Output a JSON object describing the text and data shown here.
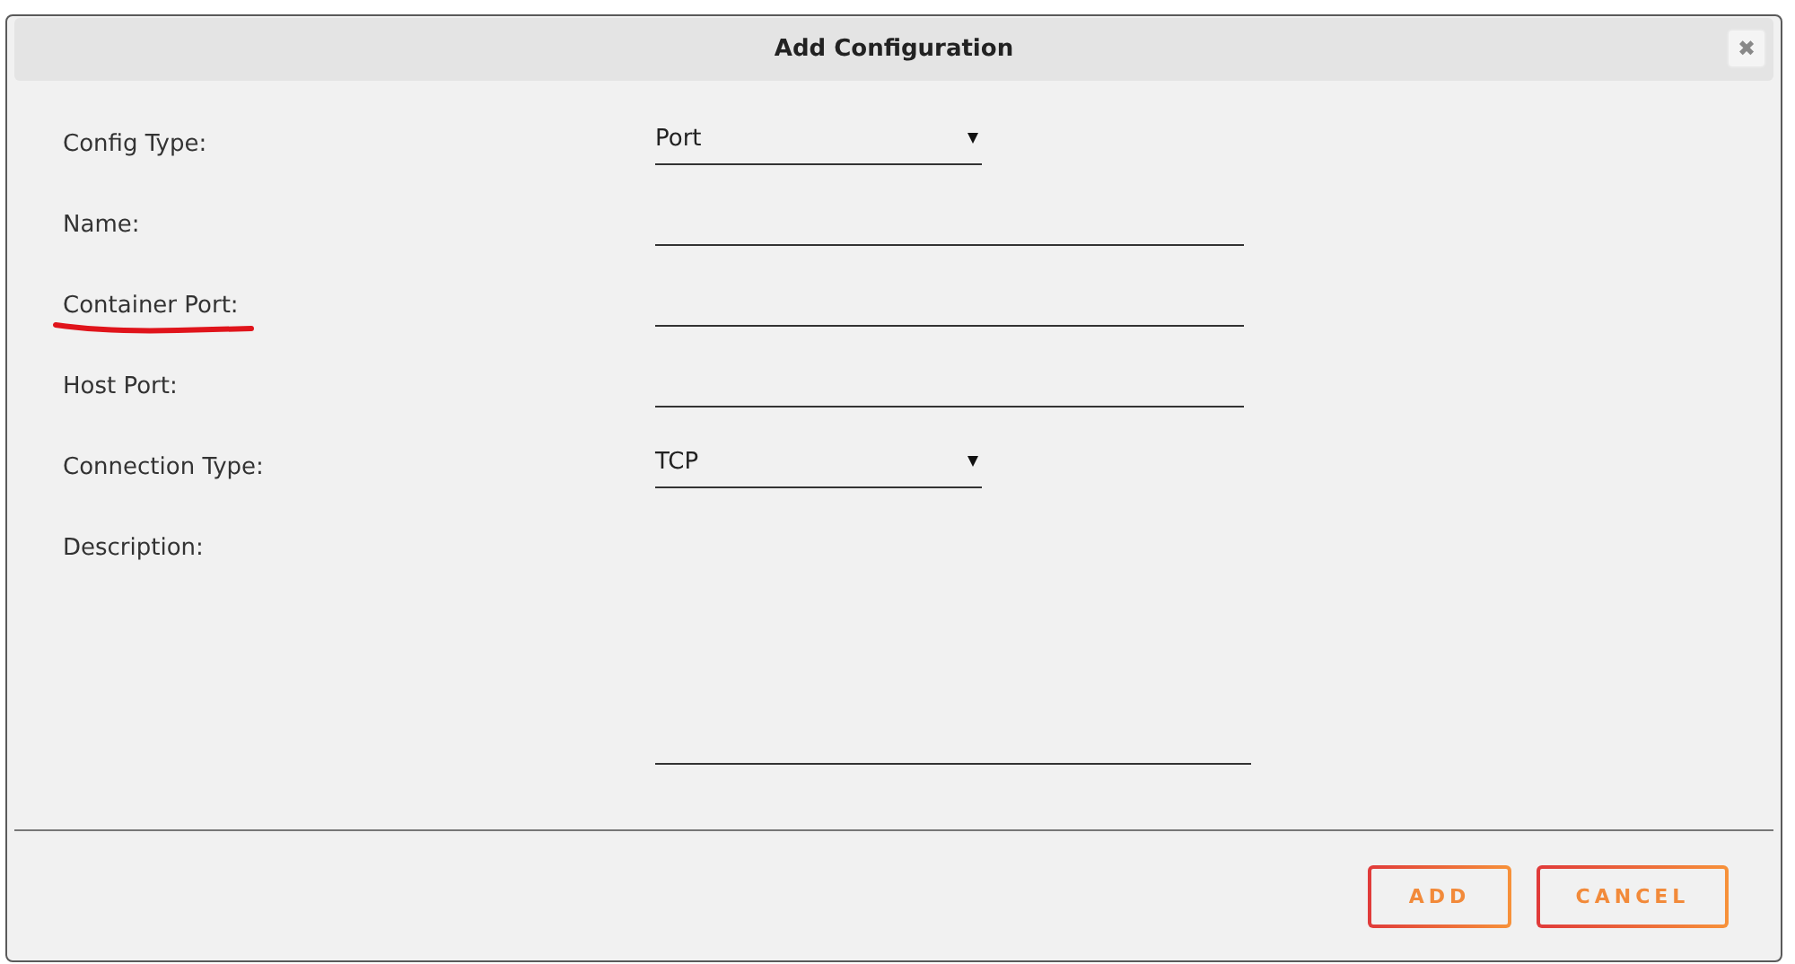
{
  "dialog": {
    "title": "Add Configuration",
    "close_icon": "✖"
  },
  "fields": [
    {
      "label": "Config Type:",
      "kind": "select",
      "value": "Port",
      "underlined": false
    },
    {
      "label": "Name:",
      "kind": "text",
      "underlined": false
    },
    {
      "label": "Container Port:",
      "kind": "text",
      "underlined": true
    },
    {
      "label": "Host Port:",
      "kind": "text",
      "underlined": false
    },
    {
      "label": "Connection Type:",
      "kind": "select",
      "value": "TCP",
      "underlined": false
    },
    {
      "label": "Description:",
      "kind": "textarea",
      "underlined": false
    }
  ],
  "buttons": [
    "ADD",
    "CANCEL"
  ]
}
